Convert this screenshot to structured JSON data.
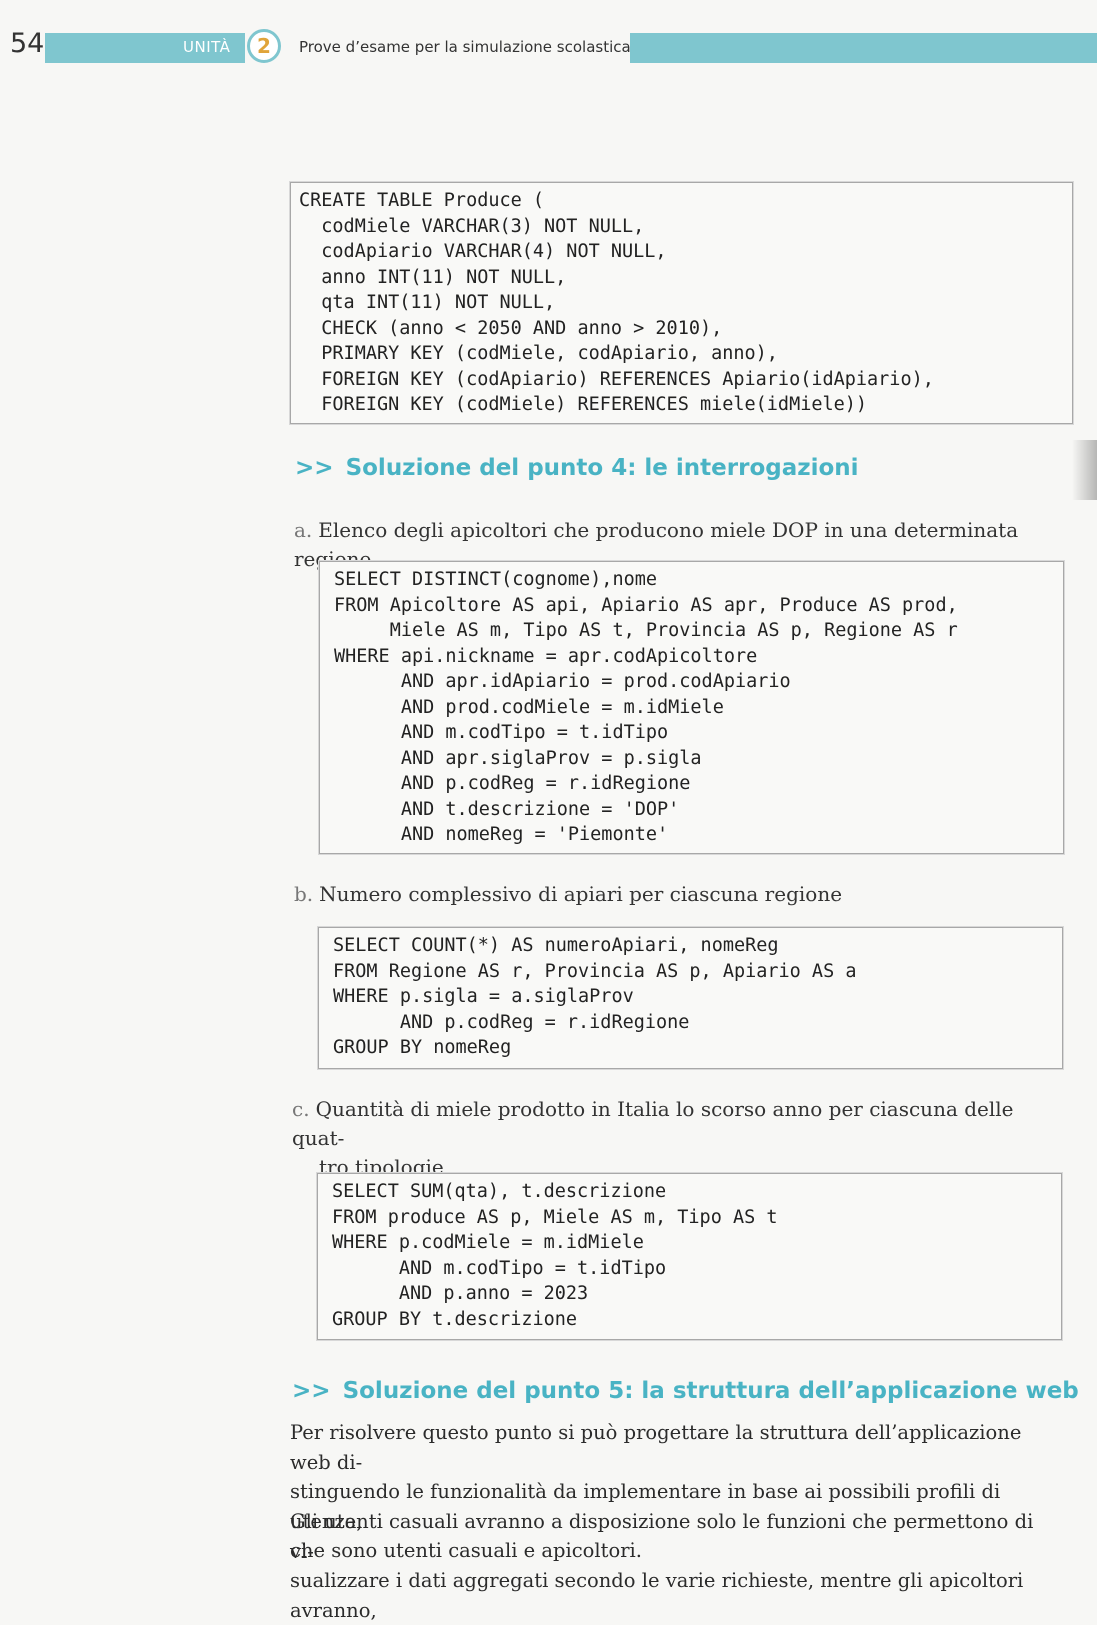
{
  "header": {
    "page_number": "54",
    "unit_label": "UNITÀ",
    "unit_number": "2",
    "title": "Prove d’esame per la simulazione scolastica"
  },
  "code_blocks": {
    "create_table": "CREATE TABLE Produce (\n  codMiele VARCHAR(3) NOT NULL,\n  codApiario VARCHAR(4) NOT NULL,\n  anno INT(11) NOT NULL,\n  qta INT(11) NOT NULL,\n  CHECK (anno < 2050 AND anno > 2010),\n  PRIMARY KEY (codMiele, codApiario, anno),\n  FOREIGN KEY (codApiario) REFERENCES Apiario(idApiario),\n  FOREIGN KEY (codMiele) REFERENCES miele(idMiele))",
    "query_a": "SELECT DISTINCT(cognome),nome\nFROM Apicoltore AS api, Apiario AS apr, Produce AS prod,\n     Miele AS m, Tipo AS t, Provincia AS p, Regione AS r\nWHERE api.nickname = apr.codApicoltore\n      AND apr.idApiario = prod.codApiario\n      AND prod.codMiele = m.idMiele\n      AND m.codTipo = t.idTipo\n      AND apr.siglaProv = p.sigla\n      AND p.codReg = r.idRegione\n      AND t.descrizione = 'DOP'\n      AND nomeReg = 'Piemonte'",
    "query_b": "SELECT COUNT(*) AS numeroApiari, nomeReg\nFROM Regione AS r, Provincia AS p, Apiario AS a\nWHERE p.sigla = a.siglaProv\n      AND p.codReg = r.idRegione\nGROUP BY nomeReg",
    "query_c": "SELECT SUM(qta), t.descrizione\nFROM produce AS p, Miele AS m, Tipo AS t\nWHERE p.codMiele = m.idMiele\n      AND m.codTipo = t.idTipo\n      AND p.anno = 2023\nGROUP BY t.descrizione"
  },
  "sections": {
    "point4": {
      "arrows": ">>",
      "title": "Soluzione del punto 4: le interrogazioni"
    },
    "point5": {
      "arrows": ">>",
      "title": "Soluzione del punto 5: la struttura dell’applicazione web"
    }
  },
  "items": {
    "a": {
      "letter": "a.",
      "text": "Elenco degli apicoltori che producono miele DOP in una determinata regione"
    },
    "b": {
      "letter": "b.",
      "text": "Numero complessivo di apiari per ciascuna regione"
    },
    "c": {
      "letter": "c.",
      "text_line1": "Quantità di miele prodotto in Italia lo scorso anno per ciascuna delle quat-",
      "text_line2": "tro tipologie"
    }
  },
  "paragraphs": {
    "p1": [
      "Per risolvere questo punto si può progettare la struttura dell’applicazione web di-",
      "stinguendo le funzionalità da implementare in base ai possibili profili di utenza,",
      "che sono utenti casuali e apicoltori."
    ],
    "p2": [
      "Gli utenti casuali avranno a disposizione solo le funzioni che permettono di vi-",
      "sualizzare i dati aggregati secondo le varie richieste, mentre gli apicoltori avranno,"
    ]
  }
}
